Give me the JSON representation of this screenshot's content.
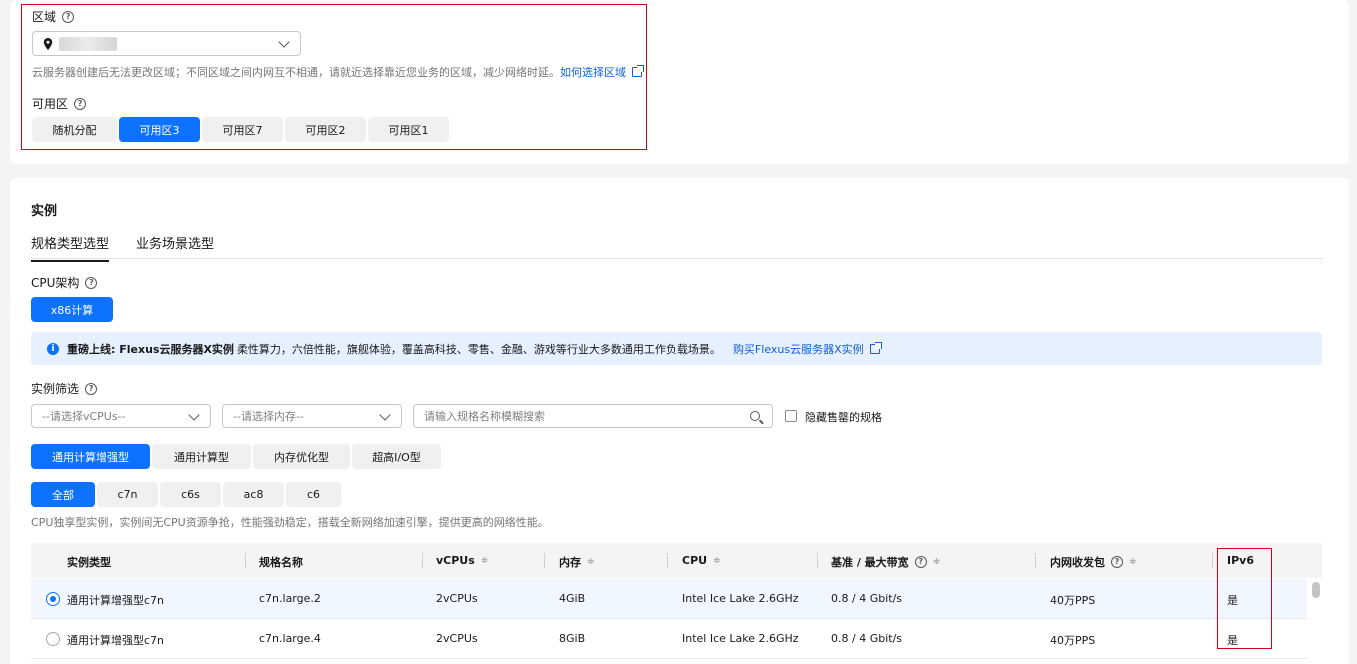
{
  "region": {
    "label": "区域",
    "hint": "云服务器创建后无法更改区域；不同区域之间内网互不相通，请就近选择靠近您业务的区域，减少网络时延。",
    "hint_link": "如何选择区域"
  },
  "zone": {
    "label": "可用区",
    "options": [
      "随机分配",
      "可用区3",
      "可用区7",
      "可用区2",
      "可用区1"
    ],
    "selected_index": 1
  },
  "instance": {
    "title": "实例",
    "tabs": [
      "规格类型选型",
      "业务场景选型"
    ],
    "cpu_arch_label": "CPU架构",
    "cpu_arch_option": "x86计算",
    "banner": {
      "bold": "重磅上线: Flexus云服务器X实例",
      "text": "柔性算力，六倍性能，旗舰体验，覆盖高科技、零售、金融、游戏等行业大多数通用工作负载场景。",
      "link": "购买Flexus云服务器X实例"
    },
    "filter_label": "实例筛选",
    "vcpu_placeholder": "--请选择vCPUs--",
    "mem_placeholder": "--请选择内存--",
    "search_placeholder": "请输入规格名称模糊搜索",
    "hide_soldout_label": "隐藏售罄的规格",
    "types": [
      "通用计算增强型",
      "通用计算型",
      "内存优化型",
      "超高I/O型"
    ],
    "families": [
      "全部",
      "c7n",
      "c6s",
      "ac8",
      "c6"
    ],
    "family_desc": "CPU独享型实例，实例间无CPU资源争抢，性能强劲稳定，搭载全新网络加速引擎，提供更高的网络性能。"
  },
  "table": {
    "headers": [
      "实例类型",
      "规格名称",
      "vCPUs",
      "内存",
      "CPU",
      "基准 / 最大带宽",
      "内网收发包",
      "IPv6"
    ],
    "rows": [
      {
        "type": "通用计算增强型c7n",
        "name": "c7n.large.2",
        "vcpus": "2vCPUs",
        "mem": "4GiB",
        "cpu": "Intel Ice Lake 2.6GHz",
        "bw": "0.8 / 4 Gbit/s",
        "pps": "40万PPS",
        "ipv6": "是",
        "selected": true
      },
      {
        "type": "通用计算增强型c7n",
        "name": "c7n.large.4",
        "vcpus": "2vCPUs",
        "mem": "8GiB",
        "cpu": "Intel Ice Lake 2.6GHz",
        "bw": "0.8 / 4 Gbit/s",
        "pps": "40万PPS",
        "ipv6": "是",
        "selected": false
      }
    ]
  },
  "colors": {
    "accent": "#0d72ff",
    "highlight_border": "#d9001b",
    "link": "#0e5fd8"
  }
}
